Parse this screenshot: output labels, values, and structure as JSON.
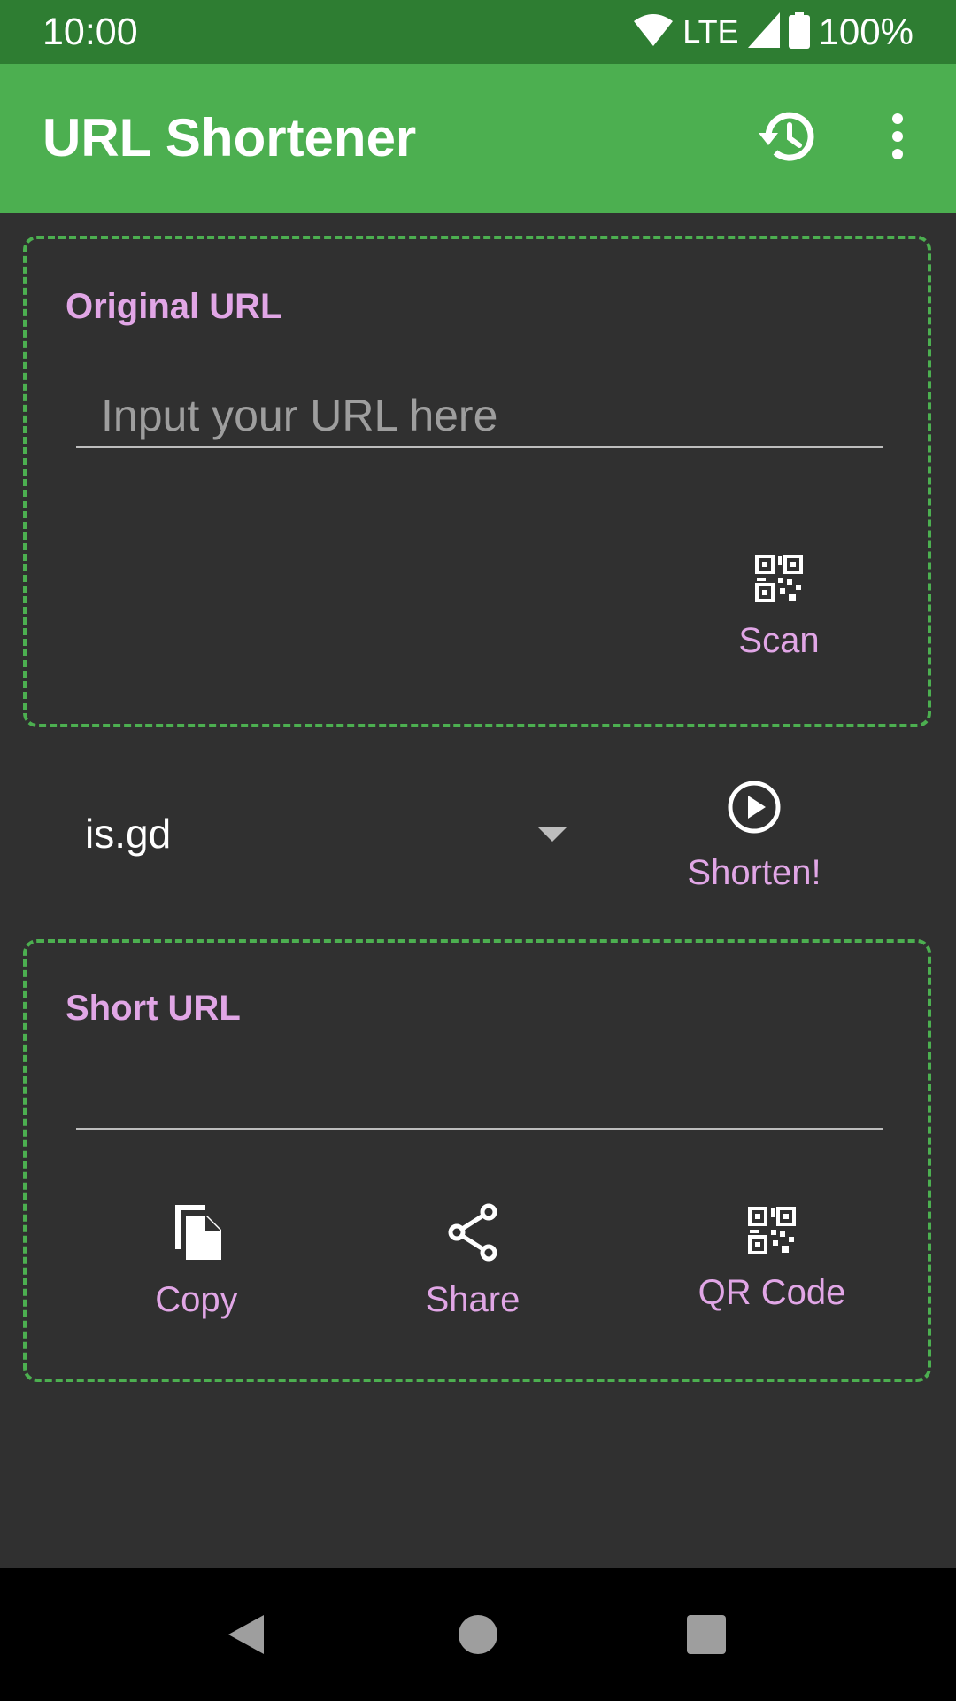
{
  "status_bar": {
    "time": "10:00",
    "network": "LTE",
    "battery": "100%",
    "icons": [
      "wifi-icon",
      "signal-icon",
      "battery-icon"
    ]
  },
  "app_bar": {
    "title": "URL Shortener",
    "icons": [
      "history-icon",
      "more-vert-icon"
    ]
  },
  "original_url": {
    "label": "Original URL",
    "placeholder": "Input your URL here",
    "value": "",
    "scan_label": "Scan",
    "scan_icon": "qr-code-icon"
  },
  "service": {
    "selected": "is.gd",
    "shorten_label": "Shorten!",
    "shorten_icon": "play-circle-icon"
  },
  "short_url": {
    "label": "Short URL",
    "value": "",
    "copy_label": "Copy",
    "share_label": "Share",
    "qr_label": "QR Code",
    "icons": [
      "copy-icon",
      "share-icon",
      "qr-code-icon"
    ]
  },
  "nav_bar": {
    "icons": [
      "back-icon",
      "home-icon",
      "recents-icon"
    ]
  },
  "colors": {
    "status_bar": "#2e7d32",
    "app_bar": "#4caf50",
    "background": "#303030",
    "accent": "#e1a6e6",
    "card_border": "#4caf50"
  }
}
